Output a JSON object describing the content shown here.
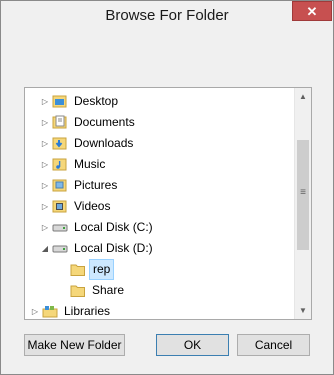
{
  "dialog": {
    "title": "Browse For Folder",
    "close_glyph": "✕"
  },
  "tree": {
    "items": [
      {
        "label": "Desktop",
        "icon": "desktop-folder-icon",
        "expander": "collapsed"
      },
      {
        "label": "Documents",
        "icon": "documents-folder-icon",
        "expander": "collapsed"
      },
      {
        "label": "Downloads",
        "icon": "downloads-folder-icon",
        "expander": "collapsed"
      },
      {
        "label": "Music",
        "icon": "music-folder-icon",
        "expander": "collapsed"
      },
      {
        "label": "Pictures",
        "icon": "pictures-folder-icon",
        "expander": "collapsed"
      },
      {
        "label": "Videos",
        "icon": "videos-folder-icon",
        "expander": "collapsed"
      },
      {
        "label": "Local Disk (C:)",
        "icon": "local-disk-icon",
        "expander": "collapsed"
      },
      {
        "label": "Local Disk (D:)",
        "icon": "local-disk-icon",
        "expander": "expanded"
      },
      {
        "label": "rep",
        "icon": "folder-icon",
        "expander": "none",
        "selected": true
      },
      {
        "label": "Share",
        "icon": "folder-icon",
        "expander": "none"
      },
      {
        "label": "Libraries",
        "icon": "libraries-icon",
        "expander": "collapsed"
      }
    ],
    "glyphs": {
      "collapsed": "▷",
      "expanded": "◢",
      "scroll_up": "▲",
      "scroll_down": "▼",
      "grip": "≡"
    }
  },
  "buttons": {
    "make_new_folder": "Make New Folder",
    "ok": "OK",
    "cancel": "Cancel"
  },
  "colors": {
    "selection_bg": "#cce8ff",
    "selection_border": "#99d1ff",
    "close_button": "#c75050",
    "folder_yellow": "#f5d77a"
  }
}
